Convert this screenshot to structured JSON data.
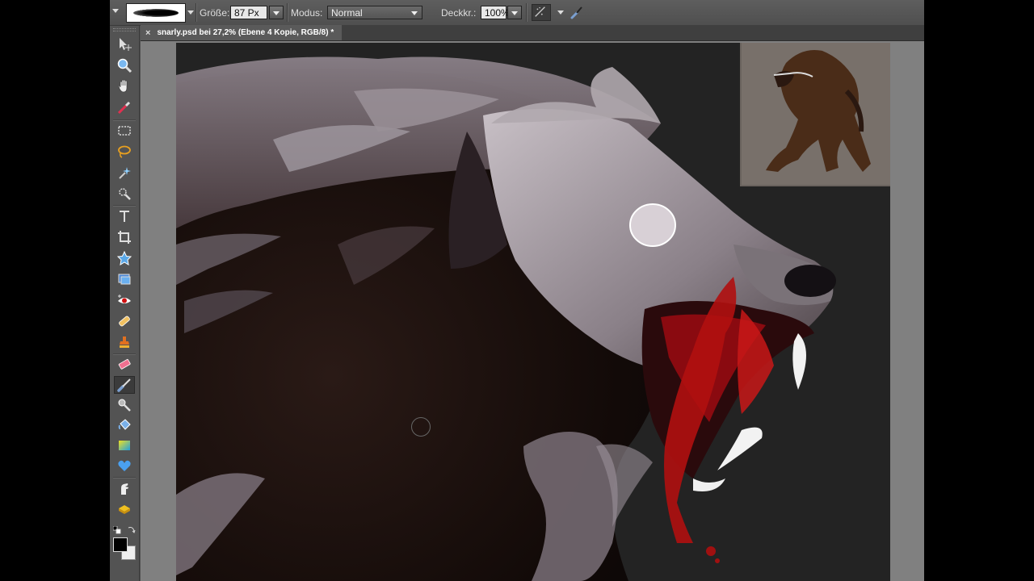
{
  "options_bar": {
    "size_label": "Größe:",
    "size_value": "87 Px",
    "mode_label": "Modus:",
    "mode_value": "Normal",
    "opacity_label": "Deckkr.:",
    "opacity_value": "100%"
  },
  "document": {
    "close_glyph": "×",
    "tab_title": "snarly.psd bei 27,2% (Ebene 4 Kopie, RGB/8) *"
  },
  "tools": {
    "items": [
      {
        "name": "move-tool-icon"
      },
      {
        "name": "zoom-tool-icon"
      },
      {
        "name": "hand-tool-icon"
      },
      {
        "name": "eyedropper-tool-icon"
      },
      {
        "name": "marquee-tool-icon"
      },
      {
        "name": "lasso-tool-icon"
      },
      {
        "name": "magic-wand-tool-icon"
      },
      {
        "name": "quick-selection-tool-icon"
      },
      {
        "name": "type-tool-icon"
      },
      {
        "name": "crop-tool-icon"
      },
      {
        "name": "cookie-cutter-tool-icon"
      },
      {
        "name": "recompose-tool-icon"
      },
      {
        "name": "red-eye-tool-icon"
      },
      {
        "name": "healing-brush-tool-icon"
      },
      {
        "name": "clone-stamp-tool-icon"
      },
      {
        "name": "eraser-tool-icon"
      },
      {
        "name": "brush-tool-icon"
      },
      {
        "name": "smart-brush-tool-icon"
      },
      {
        "name": "paint-bucket-tool-icon"
      },
      {
        "name": "gradient-tool-icon"
      },
      {
        "name": "custom-shape-tool-icon"
      },
      {
        "name": "smudge-tool-icon"
      },
      {
        "name": "sponge-tool-icon"
      }
    ],
    "active": "brush-tool-icon",
    "foreground_color": "#000000",
    "background_color": "#eeeeee"
  },
  "colors": {
    "canvas_bg": "#232323",
    "workspace_bg": "#808080",
    "fur_light": "#8a8088",
    "blood": "#b01010"
  }
}
